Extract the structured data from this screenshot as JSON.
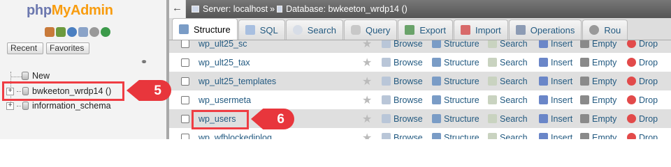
{
  "logo": {
    "php": "php",
    "myadmin": "MyAdmin"
  },
  "nav": {
    "recent": "Recent",
    "favorites": "Favorites",
    "tree": [
      {
        "label": "New"
      },
      {
        "label": "bwkeeton_wrdp14 ()"
      },
      {
        "label": "information_schema"
      }
    ]
  },
  "quick_icons": [
    "home-icon",
    "exit-icon",
    "help-icon",
    "docs-icon",
    "settings-icon",
    "reload-icon"
  ],
  "breadcrumb": {
    "server": "Server: localhost",
    "separator": "»",
    "database": "Database: bwkeeton_wrdp14 ()"
  },
  "tabs": [
    {
      "label": "Structure",
      "icon": "structure-icon",
      "active": true
    },
    {
      "label": "SQL",
      "icon": "sql-icon"
    },
    {
      "label": "Search",
      "icon": "search-icon"
    },
    {
      "label": "Query",
      "icon": "query-icon"
    },
    {
      "label": "Export",
      "icon": "export-icon"
    },
    {
      "label": "Import",
      "icon": "import-icon"
    },
    {
      "label": "Operations",
      "icon": "operations-icon"
    },
    {
      "label": "Rou",
      "icon": "routines-icon"
    }
  ],
  "actions": {
    "browse": "Browse",
    "structure": "Structure",
    "search": "Search",
    "insert": "Insert",
    "empty": "Empty",
    "drop": "Drop"
  },
  "tables": [
    {
      "name": "wp_ult25_sc"
    },
    {
      "name": "wp_ult25_tax"
    },
    {
      "name": "wp_ult25_templates"
    },
    {
      "name": "wp_usermeta"
    },
    {
      "name": "wp_users"
    },
    {
      "name": "wp_wfblockediplog"
    }
  ],
  "callouts": {
    "step5": "5",
    "step6": "6"
  },
  "colors": {
    "accent": "#ef3d43",
    "link": "#235a81",
    "logo_php": "#6c78af",
    "logo_myadmin": "#f89c0e"
  }
}
